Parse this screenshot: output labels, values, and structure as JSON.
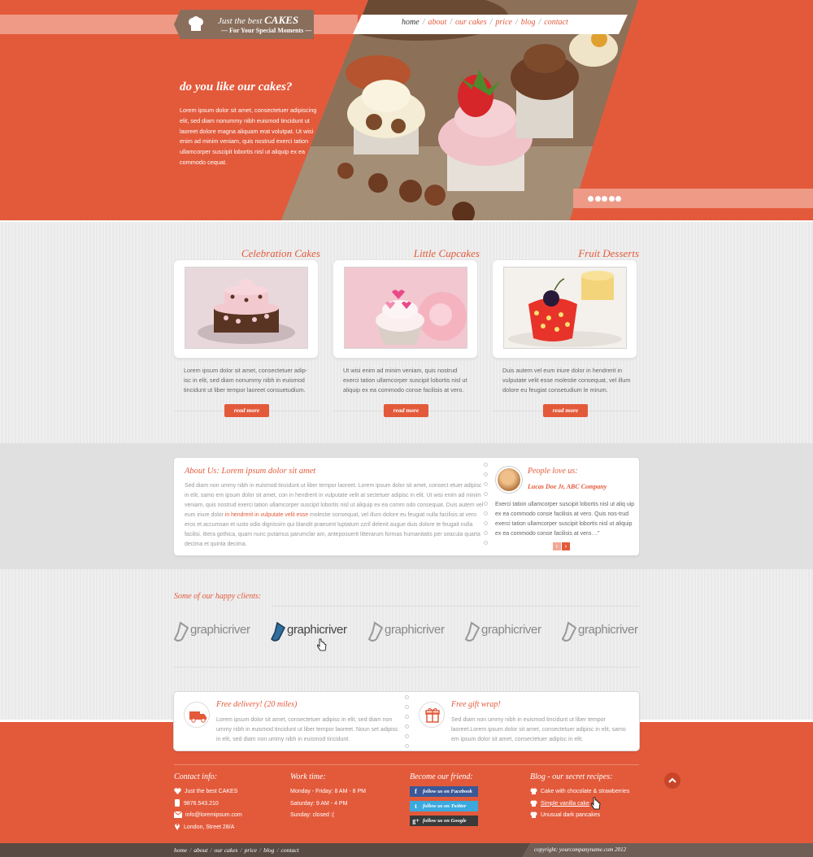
{
  "logo": {
    "line1": "Just the best",
    "line1_bold": "CAKES",
    "tagline": "For Your Special Moments"
  },
  "nav": {
    "items": [
      "home",
      "about",
      "our cakes",
      "price",
      "blog",
      "contact"
    ],
    "active": "home"
  },
  "hero": {
    "headline": "do you like our cakes?",
    "text": "Lorem ipsum dolor sit amet, consectetuer adipiscing elit, sed diam nonummy nibh euismod tincidunt ut laoreet dolore magna aliquam erat volutpat. Ut wisi enim ad minim veniam, quis nostrud exerci tation ullamcorper suscipit lobortis nisl ut aliquip ex ea commodo cequat.",
    "slide_count": 5
  },
  "products": [
    {
      "title": "Celebration Cakes",
      "text": "Lorem ipsum dolor sit amet, consectetuer adip-isc in elit, sed diam nonummy nibh in euismod tincidunt ut liber tempor laoreet consuetudium.",
      "button": "read more"
    },
    {
      "title": "Little Cupcakes",
      "text": "Ut wisi enim ad minim veniam, quis nostrud exerci tation ullamcorper suscipit lobortis nisl ut aliquip ex ea commodo conse facilisis at vero.",
      "button": "read more"
    },
    {
      "title": "Fruit Desserts",
      "text": "Duis autem vel eum iriure dolor in hendrerit in vulputate velit esse molestie consequat, vel illum dolore eu feugiat consetudium le mirum.",
      "button": "read more"
    }
  ],
  "about": {
    "title": "About Us: Lorem ipsum dolor sit amet",
    "text_before": "Sed diam non ummy nibh in euismod tincidunt ut liber tempor laoreet. Lorem ipsum dolor sit amet, consect etuer adipisc in elit, samo em ipsum dolor sit amet, con in hendrerit in vulputate velit at sectetuer adipisc in elit. Ut wisi enim ad minim veniam, quis nostrud exerci tation ullamcorper suscipit lobortis nisl ut aliquip ex ea comm odo consequat. Duis autem vel eum iriure dolor ",
    "text_link": "in hendrerit in vulputate velit esse",
    "text_after": " molestie consequat, vel illum dolore eu feugiat nulla facilisis at vero eros et accumsan et iusto odio dignissim qui blandit praesent luptatum zzril delenit augue duis dolore te feugait nulla facilisi. ittera gothica, quam nunc putamus parumclar am, anteposuerit litterarum formas humanitatis per seacula quarta decima et quinta decima."
  },
  "testimonial": {
    "heading": "People love us:",
    "author": "Lucas Doe Jr, ABC Company",
    "quote": "Exerci tation ullamcorper suscipit lobortis nisl ut aliq uip ex ea commodo conse facilisis at vero. Quis nos-trud exerci tation ullamcorper suscipit lobortis nisl ut aliquip ex ea commodo conse facilisis at vero. ..\""
  },
  "clients": {
    "title": "Some of our happy clients:",
    "names": [
      "graphicriver",
      "graphicriver",
      "graphicriver",
      "graphicriver",
      "graphicriver"
    ]
  },
  "perks": [
    {
      "title": "Free delivery! (20 miles)",
      "text": "Lorem ipsum dolor sit amet, consectetuer adipisc in elit, sed diam non ummy nibh in euismod tincidunt ut liber tempor laoreet. Noun set adipisc in elit, sed diam non ummy nibh in euismod tincidunt."
    },
    {
      "title": "Free gift wrap!",
      "text": "Sed diam non ummy nibh in euismod tincidunt ut liber tempor laoreet.Lorem ipsum dolor sit amet, consectetuer adipisc in elit, samo em ipsum dolor sit amet, consectetuer adipisc in elit."
    }
  ],
  "footer": {
    "contact": {
      "title": "Contact info:",
      "rows": [
        "Just the best CAKES",
        "9876.543.210",
        "info@loremipsum.com",
        "London, Street 28/A"
      ]
    },
    "work": {
      "title": "Work time:",
      "rows": [
        "Monday - Friday: 8 AM - 8 PM",
        "Saturday: 9 AM - 4 PM",
        "Sunday: closed :("
      ]
    },
    "social": {
      "title": "Become our friend:",
      "buttons": [
        "follow us on Facebook",
        "follow us on Twitter",
        "follow us on Google"
      ]
    },
    "blog": {
      "title": "Blog - our secret recipes:",
      "posts": [
        "Cake with chocolate & strawberries",
        "Simple vanilla cake",
        "Unusual dark pancakes"
      ]
    },
    "bottom_nav": [
      "home",
      "about",
      "our cakes",
      "price",
      "blog",
      "contact"
    ],
    "copyright": "copyright: yourcompanyname.com 2012"
  },
  "colors": {
    "accent": "#e35a3b",
    "brown": "#8a6e5c",
    "dark_bar": "#594a44",
    "facebook": "#3b5998",
    "twitter": "#3ba9dd",
    "google": "#3a3a3a"
  }
}
